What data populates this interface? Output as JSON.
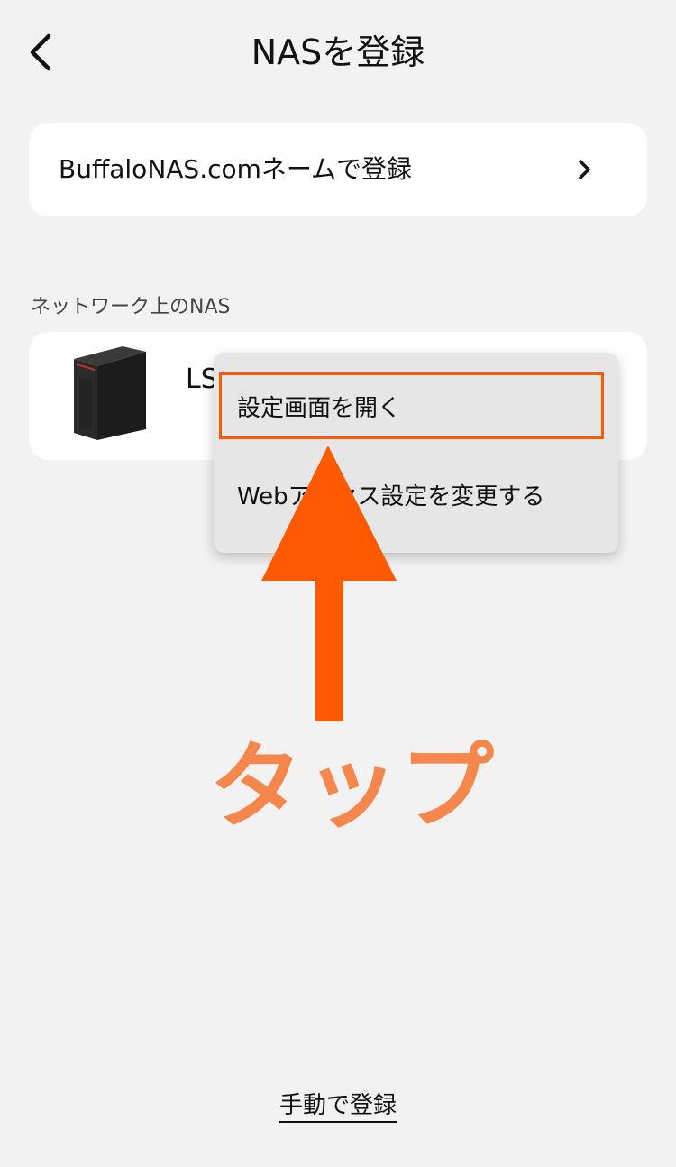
{
  "header": {
    "title": "NASを登録",
    "back_icon": "chevron-left-icon"
  },
  "register_card": {
    "label": "BuffaloNAS.comネームで登録",
    "chevron_icon": "chevron-right-icon"
  },
  "section": {
    "label": "ネットワーク上のNAS"
  },
  "nas_card": {
    "name": "LS",
    "image_icon": "nas-device-icon"
  },
  "context_menu": {
    "items": [
      {
        "label": "設定画面を開く"
      },
      {
        "label": "Webアクセス設定を変更する"
      }
    ]
  },
  "annotation": {
    "tap_label": "タップ",
    "accent_color": "#ff5a00",
    "tap_text_color": "#f5874d"
  },
  "footer": {
    "manual_register": "手動で登録"
  }
}
